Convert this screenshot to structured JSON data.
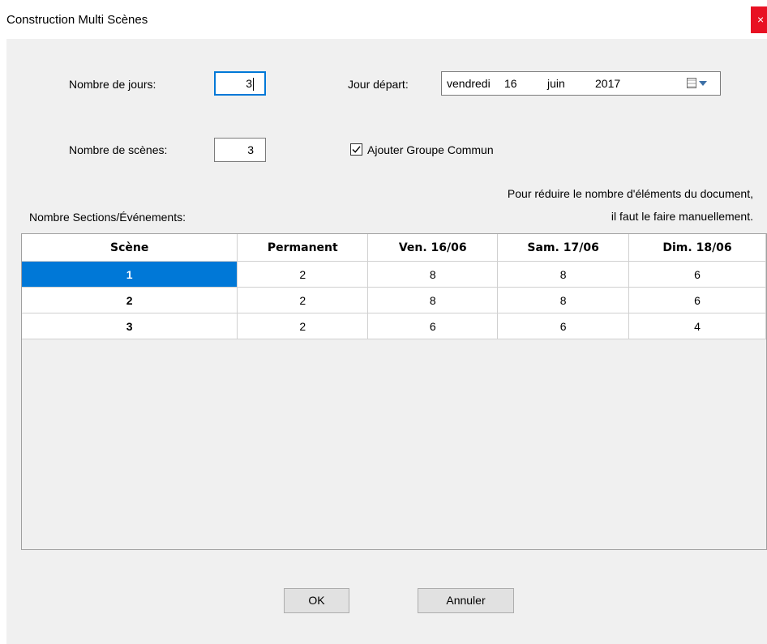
{
  "window": {
    "title": "Construction Multi Scènes",
    "close_glyph": "×"
  },
  "form": {
    "jours_label": "Nombre de jours:",
    "jours_value": "3",
    "scenes_label": "Nombre de scènes:",
    "scenes_value": "3",
    "depart_label": "Jour départ:",
    "depart_day_name": "vendredi",
    "depart_day": "16",
    "depart_month": "juin",
    "depart_year": "2017",
    "groupe_commun_label": "Ajouter Groupe Commun",
    "groupe_commun_checked": true,
    "sections_label": "Nombre Sections/Événements:",
    "note_line1": "Pour réduire le nombre d'éléments du document,",
    "note_line2": "il faut le faire manuellement."
  },
  "table": {
    "columns": [
      "Scène",
      "Permanent",
      "Ven. 16/06",
      "Sam. 17/06",
      "Dim. 18/06"
    ],
    "rows": [
      [
        "1",
        "2",
        "8",
        "8",
        "6"
      ],
      [
        "2",
        "2",
        "8",
        "8",
        "6"
      ],
      [
        "3",
        "2",
        "6",
        "6",
        "4"
      ]
    ],
    "selected_row": 0
  },
  "buttons": {
    "ok_label": "OK",
    "cancel_label": "Annuler"
  },
  "colors": {
    "selection": "#0078d7",
    "close": "#e81123",
    "focus_border": "#0078d7"
  }
}
